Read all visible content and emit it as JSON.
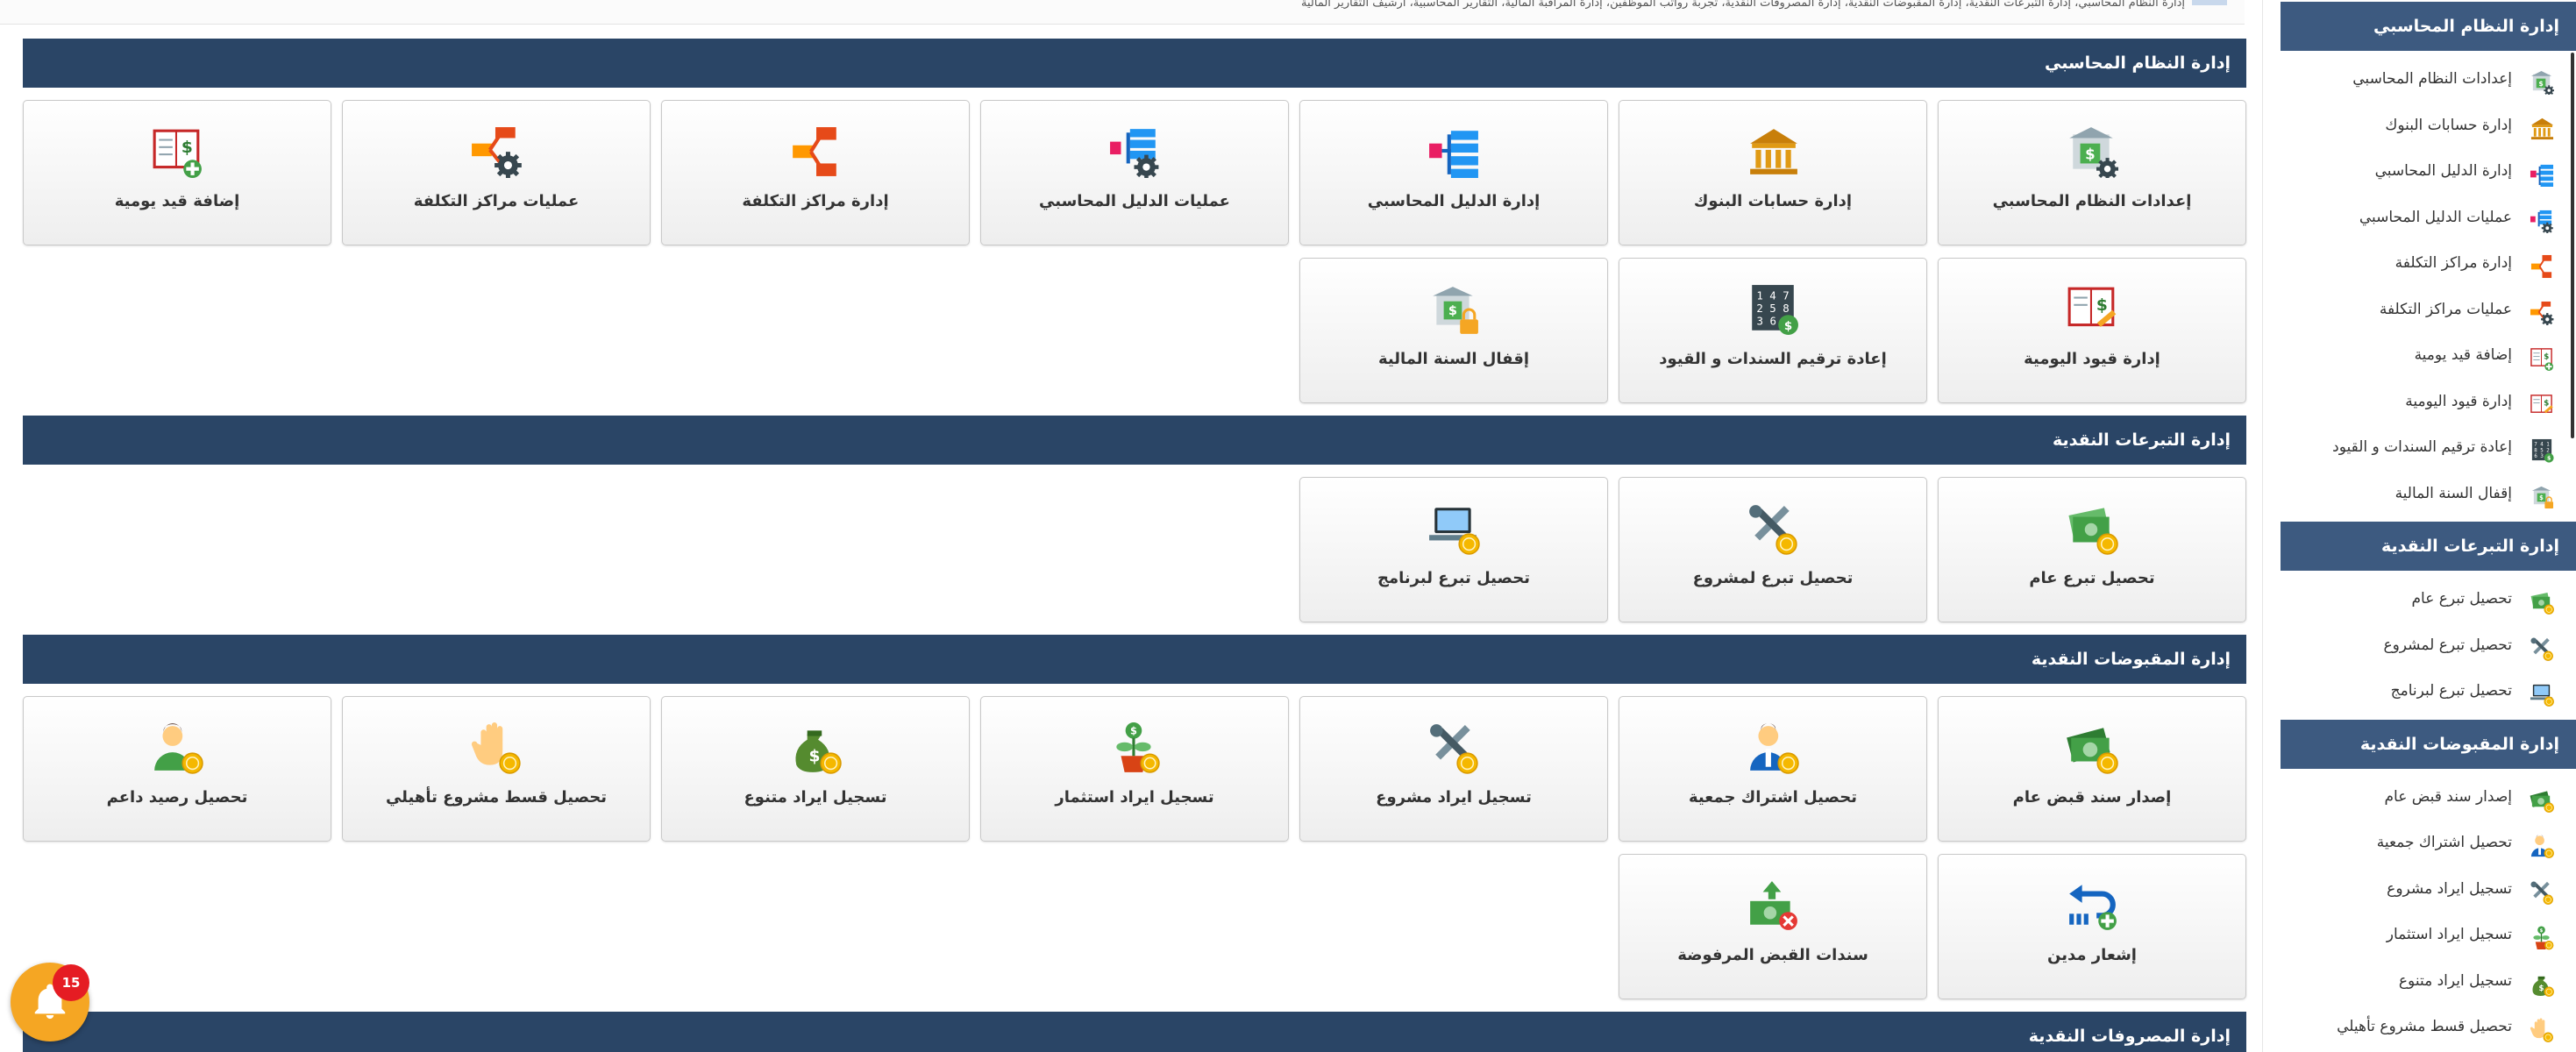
{
  "breadcrumb_text": "إدارة النظام المحاسبي، إدارة التبرعات النقدية، إدارة المقبوضات النقدية، إدارة المصروفات النقدية، تجربة رواتب الموظفين، إدارة المراقبة المالية، التقارير المحاسبية، أرشيف التقارير المالية",
  "sections": [
    {
      "title": "إدارة النظام المحاسبي",
      "cards": [
        {
          "label": "إعدادات النظام المحاسبي",
          "icon": "bank-settings-icon"
        },
        {
          "label": "إدارة حسابات البنوك",
          "icon": "bank-icon"
        },
        {
          "label": "إدارة الدليل المحاسبي",
          "icon": "hierarchy-icon"
        },
        {
          "label": "عمليات الدليل المحاسبي",
          "icon": "hierarchy-gear-icon"
        },
        {
          "label": "إدارة مراكز التكلفة",
          "icon": "share-icon"
        },
        {
          "label": "عمليات مراكز التكلفة",
          "icon": "share-gear-icon"
        },
        {
          "label": "إضافة قيد يومية",
          "icon": "ledger-add-icon"
        },
        {
          "label": "إدارة قيود اليومية",
          "icon": "ledger-edit-icon"
        },
        {
          "label": "إعادة ترقيم السندات و القيود",
          "icon": "renumber-icon"
        },
        {
          "label": "إقفال السنة المالية",
          "icon": "bank-lock-icon"
        }
      ]
    },
    {
      "title": "إدارة التبرعات النقدية",
      "cards": [
        {
          "label": "تحصيل تبرع عام",
          "icon": "cash-coin-icon"
        },
        {
          "label": "تحصيل تبرع لمشروع",
          "icon": "tools-coin-icon"
        },
        {
          "label": "تحصيل تبرع لبرنامج",
          "icon": "laptop-coin-icon"
        }
      ]
    },
    {
      "title": "إدارة المقبوضات النقدية",
      "cards": [
        {
          "label": "إصدار سند قبض عام",
          "icon": "money-coin-icon"
        },
        {
          "label": "تحصيل اشتراك جمعية",
          "icon": "user-coin-icon"
        },
        {
          "label": "تسجيل ايراد مشروع",
          "icon": "tools-coin-icon"
        },
        {
          "label": "تسجيل ايراد استثمار",
          "icon": "plant-coin-icon"
        },
        {
          "label": "تسجيل ايراد متنوع",
          "icon": "moneybag-coin-icon"
        },
        {
          "label": "تحصيل قسط مشروع تأهيلي",
          "icon": "hand-coin-icon"
        },
        {
          "label": "تحصيل رصيد داعم",
          "icon": "user-green-coin-icon"
        },
        {
          "label": "إشعار مدين",
          "icon": "debit-note-icon"
        },
        {
          "label": "سندات القبض المرفوضة",
          "icon": "money-reject-icon"
        }
      ]
    },
    {
      "title": "إدارة المصروفات النقدية",
      "cards": []
    }
  ],
  "sidebar": {
    "groups": [
      {
        "title": "إدارة النظام المحاسبي",
        "items": [
          {
            "label": "إعدادات النظام المحاسبي",
            "icon": "bank-settings-icon"
          },
          {
            "label": "إدارة حسابات البنوك",
            "icon": "bank-icon"
          },
          {
            "label": "إدارة الدليل المحاسبي",
            "icon": "hierarchy-icon"
          },
          {
            "label": "عمليات الدليل المحاسبي",
            "icon": "hierarchy-gear-icon"
          },
          {
            "label": "إدارة مراكز التكلفة",
            "icon": "share-icon"
          },
          {
            "label": "عمليات مراكز التكلفة",
            "icon": "share-gear-icon"
          },
          {
            "label": "إضافة قيد يومية",
            "icon": "ledger-add-icon"
          },
          {
            "label": "إدارة قيود اليومية",
            "icon": "ledger-edit-icon"
          },
          {
            "label": "إعادة ترقيم السندات و القيود",
            "icon": "renumber-icon"
          },
          {
            "label": "إقفال السنة المالية",
            "icon": "bank-lock-icon"
          }
        ]
      },
      {
        "title": "إدارة التبرعات النقدية",
        "items": [
          {
            "label": "تحصيل تبرع عام",
            "icon": "cash-coin-icon"
          },
          {
            "label": "تحصيل تبرع لمشروع",
            "icon": "tools-coin-icon"
          },
          {
            "label": "تحصيل تبرع لبرنامج",
            "icon": "laptop-coin-icon"
          }
        ]
      },
      {
        "title": "إدارة المقبوضات النقدية",
        "items": [
          {
            "label": "إصدار سند قبض عام",
            "icon": "money-coin-icon"
          },
          {
            "label": "تحصيل اشتراك جمعية",
            "icon": "user-coin-icon"
          },
          {
            "label": "تسجيل ايراد مشروع",
            "icon": "tools-coin-icon"
          },
          {
            "label": "تسجيل ايراد استثمار",
            "icon": "plant-coin-icon"
          },
          {
            "label": "تسجيل ايراد متنوع",
            "icon": "moneybag-coin-icon"
          },
          {
            "label": "تحصيل قسط مشروع تأهيلي",
            "icon": "hand-coin-icon"
          }
        ]
      }
    ]
  },
  "notifications": {
    "count": "15"
  },
  "colors": {
    "section_bar": "#2a4566",
    "sidebar_header": "#3d5a80",
    "bell": "#f5a623",
    "badge": "#e51c23",
    "coin": "#f5b800",
    "money_green": "#4caf50"
  }
}
